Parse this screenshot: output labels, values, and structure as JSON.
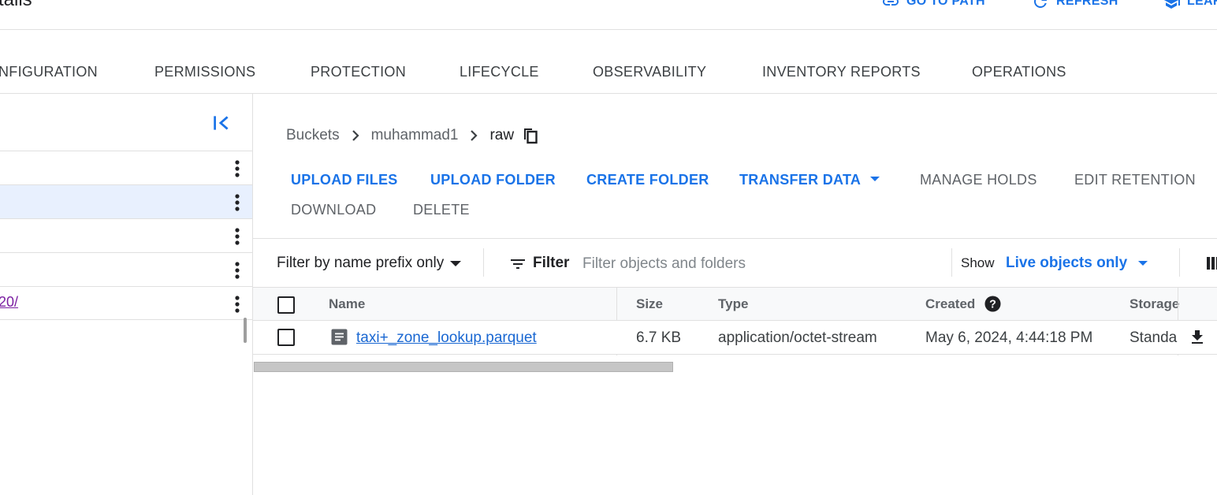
{
  "header": {
    "title": "tails",
    "actions": [
      {
        "label": "GO TO PATH",
        "icon": "link-icon"
      },
      {
        "label": "REFRESH",
        "icon": "refresh-icon"
      },
      {
        "label": "LEAR",
        "icon": "school-icon"
      }
    ]
  },
  "tabs": [
    "NFIGURATION",
    "PERMISSIONS",
    "PROTECTION",
    "LIFECYCLE",
    "OBSERVABILITY",
    "INVENTORY REPORTS",
    "OPERATIONS"
  ],
  "folder_tree": {
    "rows": [
      {
        "label": ""
      },
      {
        "label": "",
        "selected": true
      },
      {
        "label": ""
      },
      {
        "label": ""
      },
      {
        "label": "20/"
      }
    ]
  },
  "breadcrumb": {
    "items": [
      "Buckets",
      "muhammad1"
    ],
    "current": "raw"
  },
  "toolbar": {
    "upload_files": "UPLOAD FILES",
    "upload_folder": "UPLOAD FOLDER",
    "create_folder": "CREATE FOLDER",
    "transfer_data": "TRANSFER DATA",
    "manage_holds": "MANAGE HOLDS",
    "edit_retention": "EDIT RETENTION",
    "download": "DOWNLOAD",
    "delete": "DELETE"
  },
  "filter": {
    "mode": "Filter by name prefix only",
    "label": "Filter",
    "placeholder": "Filter objects and folders",
    "show_label": "Show",
    "show_value": "Live objects only"
  },
  "table": {
    "columns": [
      "Name",
      "Size",
      "Type",
      "Created",
      "Storage"
    ],
    "rows": [
      {
        "name": "taxi+_zone_lookup.parquet",
        "size": "6.7 KB",
        "type": "application/octet-stream",
        "created": "May 6, 2024, 4:44:18 PM",
        "storage": "Standa"
      }
    ]
  },
  "colors": {
    "accent": "#1a73e8",
    "selected_row": "#e8f0fe",
    "visited_link": "#7b1fa2"
  }
}
